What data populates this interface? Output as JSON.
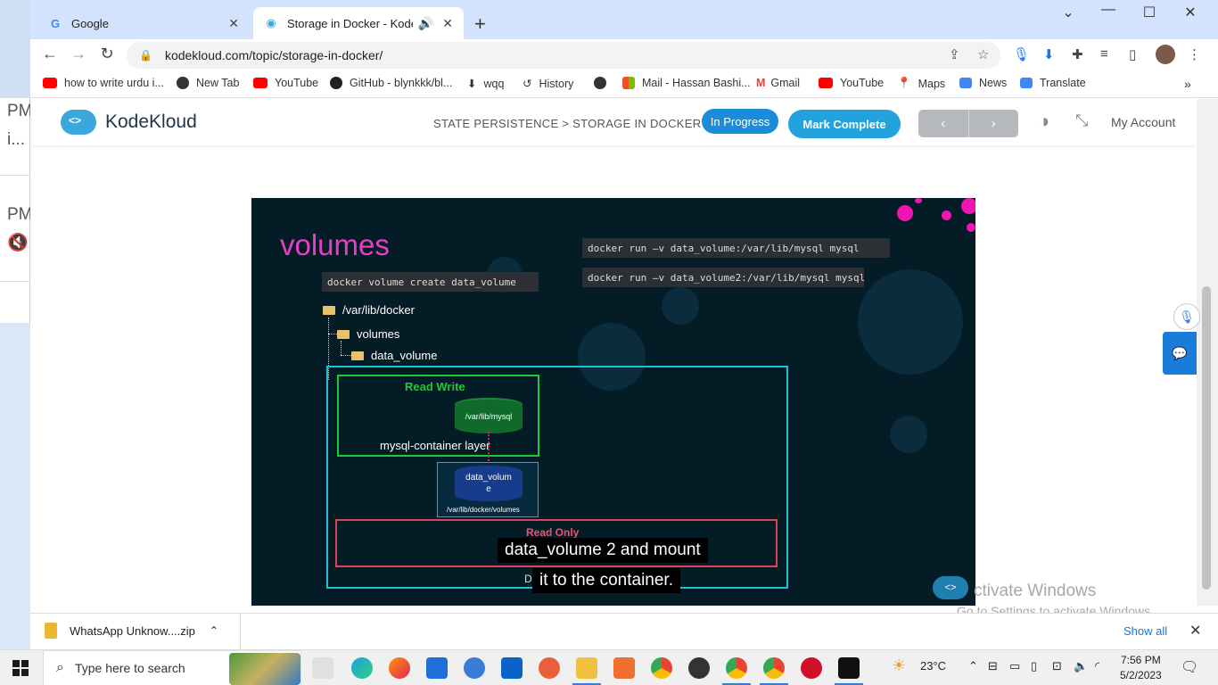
{
  "browser": {
    "tabs": [
      {
        "title": "Google",
        "active": false,
        "icon": "google-icon"
      },
      {
        "title": "Storage in Docker - KodeKlo",
        "active": true,
        "icon": "kodekloud-icon"
      }
    ],
    "url": "kodekloud.com/topic/storage-in-docker/",
    "bookmarks": [
      {
        "label": "how to write urdu i...",
        "icon": "youtube-icon",
        "color": "#ff0000"
      },
      {
        "label": "New Tab",
        "icon": "globe-icon",
        "color": "#333333"
      },
      {
        "label": "YouTube",
        "icon": "youtube-icon",
        "color": "#ff0000"
      },
      {
        "label": "GitHub - blynkkk/bl...",
        "icon": "github-icon",
        "color": "#222222"
      },
      {
        "label": "wqq",
        "icon": "download-icon",
        "color": "#333333"
      },
      {
        "label": "History",
        "icon": "history-icon",
        "color": "#333333"
      },
      {
        "label": "",
        "icon": "globe-icon",
        "color": "#333333"
      },
      {
        "label": "Mail - Hassan Bashi...",
        "icon": "microsoft-icon",
        "color": "#f25022"
      },
      {
        "label": "Gmail",
        "icon": "gmail-icon",
        "color": "#ea4335"
      },
      {
        "label": "YouTube",
        "icon": "youtube-icon",
        "color": "#ff0000"
      },
      {
        "label": "Maps",
        "icon": "maps-icon",
        "color": "#34a853"
      },
      {
        "label": "News",
        "icon": "news-icon",
        "color": "#4285f4"
      },
      {
        "label": "Translate",
        "icon": "translate-icon",
        "color": "#4285f4"
      }
    ]
  },
  "left_window": {
    "texts": [
      "PM",
      "i...",
      "PM"
    ]
  },
  "kodekloud": {
    "brand": "KodeKloud",
    "breadcrumb": "STATE PERSISTENCE > STORAGE IN DOCKER",
    "status_button": "In Progress",
    "mark_button": "Mark Complete",
    "prev": "‹",
    "next": "›",
    "account": "My Account"
  },
  "slide": {
    "title": "volumes",
    "cmd_create": "docker volume create data_volume",
    "cmd_run1": "docker run –v data_volume:/var/lib/mysql mysql",
    "cmd_run2": "docker run –v data_volume2:/var/lib/mysql mysql",
    "tree": [
      "/var/lib/docker",
      "volumes",
      "data_volume"
    ],
    "read_write": "Read Write",
    "container_path": "/var/lib/mysql",
    "layer_label": "mysql-container layer",
    "volume_label_1": "data_volum",
    "volume_label_2": "e",
    "volume_path": "/var/lib/docker/volumes",
    "read_only": "Read Only",
    "bottom_letter": "D",
    "caption_line1": "data_volume 2 and mount",
    "caption_line2": "it to the container."
  },
  "watermark": {
    "line1": "ctivate Windows",
    "line2": "Go to Settings to activate Windows."
  },
  "download": {
    "file": "WhatsApp Unknow....zip",
    "show_all": "Show all"
  },
  "taskbar": {
    "search_placeholder": "Type here to search",
    "temperature": "23°C",
    "time": "7:56 PM",
    "date": "5/2/2023"
  }
}
